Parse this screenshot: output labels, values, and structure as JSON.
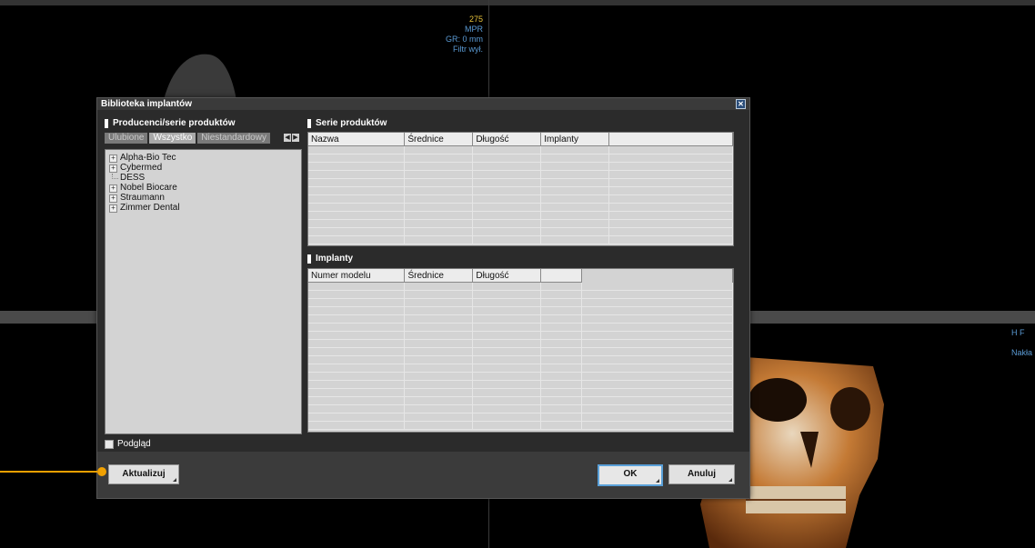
{
  "viewport": {
    "overlay_top": {
      "line1": "275",
      "line2": "MPR",
      "line3": "GR: 0 mm",
      "line4": "Filtr wył."
    },
    "overlay_right": {
      "line1": "H F",
      "line2": "Nakła"
    }
  },
  "dialog": {
    "title": "Biblioteka implantów",
    "close_label": "✕",
    "manufacturers": {
      "label": "Producenci/serie produktów",
      "tabs": [
        {
          "label": "Ulubione",
          "active": false
        },
        {
          "label": "Wszystko",
          "active": true
        },
        {
          "label": "Niestandardowy",
          "active": false
        }
      ],
      "arrow_left": "◀",
      "arrow_right": "▶",
      "tree": [
        {
          "label": "Alpha-Bio Tec",
          "expandable": true
        },
        {
          "label": "Cybermed",
          "expandable": true
        },
        {
          "label": "DESS",
          "expandable": false
        },
        {
          "label": "Nobel Biocare",
          "expandable": true
        },
        {
          "label": "Straumann",
          "expandable": true
        },
        {
          "label": "Zimmer Dental",
          "expandable": true
        }
      ]
    },
    "product_series": {
      "label": "Serie produktów",
      "columns": [
        "Nazwa",
        "Średnice",
        "Długość",
        "Implanty",
        ""
      ]
    },
    "implants": {
      "label": "Implanty",
      "columns": [
        "Numer modelu",
        "Średnice",
        "Długość",
        "",
        ""
      ]
    },
    "preview_label": "Podgląd",
    "buttons": {
      "update": "Aktualizuj",
      "ok": "OK",
      "cancel": "Anuluj"
    }
  }
}
